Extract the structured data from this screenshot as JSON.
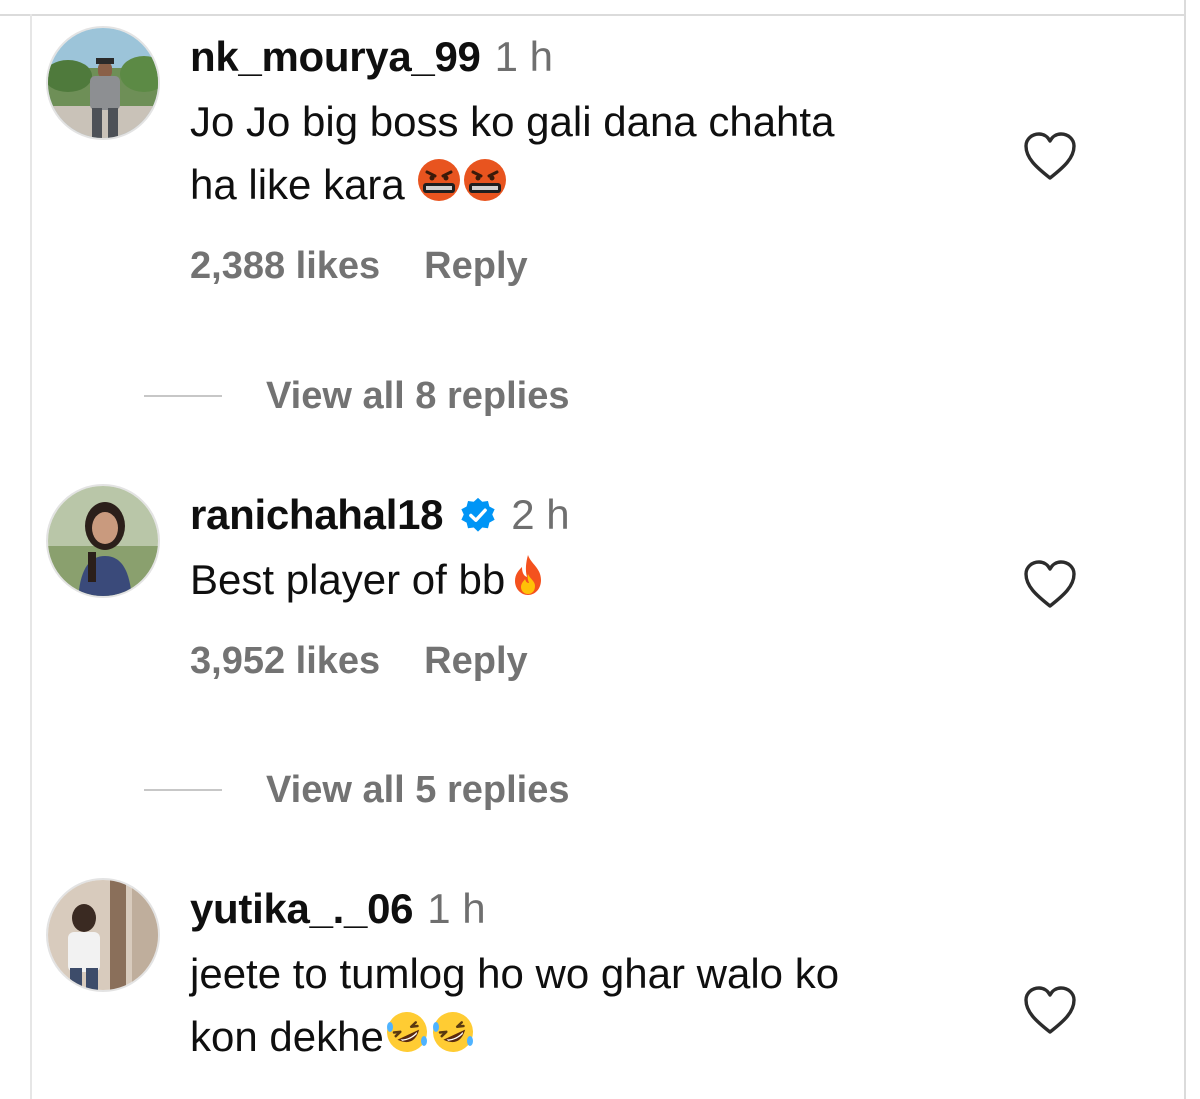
{
  "comments": [
    {
      "username": "nk_mourya_99",
      "time": "1 h",
      "verified": false,
      "text_line1": "Jo Jo big boss ko gali dana chahta",
      "text_line2": "ha like kara",
      "emojis": [
        "face-with-symbols-on-mouth",
        "face-with-symbols-on-mouth"
      ],
      "likes": "2,388 likes",
      "reply_label": "Reply",
      "view_replies": "View all 8 replies"
    },
    {
      "username": "ranichahal18",
      "time": "2 h",
      "verified": true,
      "text_line1": "Best player of bb",
      "emojis": [
        "fire"
      ],
      "likes": "3,952 likes",
      "reply_label": "Reply",
      "view_replies": "View all 5 replies"
    },
    {
      "username": "yutika_._06",
      "time": "1 h",
      "verified": false,
      "text_line1": "jeete to tumlog ho wo ghar walo ko",
      "text_line2": "kon dekhe",
      "emojis": [
        "rolling-on-the-floor-laughing",
        "rolling-on-the-floor-laughing"
      ]
    }
  ],
  "colors": {
    "primary_text": "#0f0f0f",
    "secondary_text": "#737373",
    "verified_badge": "#0095f6",
    "divider": "#dbdbdb"
  }
}
